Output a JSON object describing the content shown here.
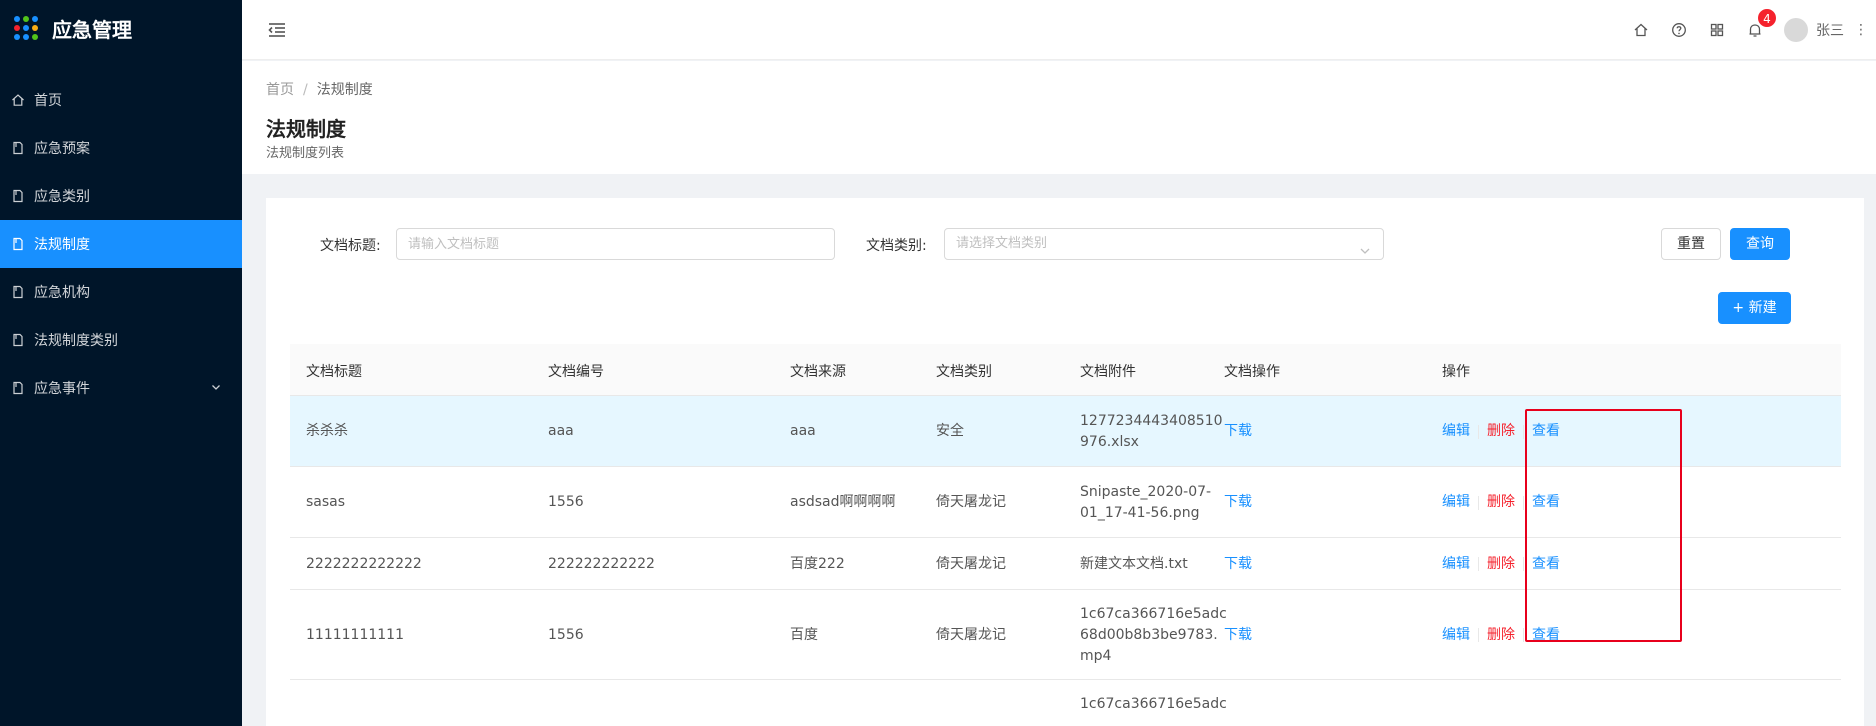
{
  "app": {
    "title": "应急管理",
    "logo_dots": [
      "#1890ff",
      "#52c41a",
      "#1890ff",
      "#f5222d",
      "#1890ff",
      "#faad14",
      "#1890ff",
      "#1890ff",
      "#52c41a"
    ]
  },
  "sidebar": {
    "items": [
      {
        "label": "首页",
        "icon": "home-icon",
        "active": false
      },
      {
        "label": "应急预案",
        "icon": "document-icon",
        "active": false
      },
      {
        "label": "应急类别",
        "icon": "document-icon",
        "active": false
      },
      {
        "label": "法规制度",
        "icon": "document-icon",
        "active": true
      },
      {
        "label": "应急机构",
        "icon": "document-icon",
        "active": false
      },
      {
        "label": "法规制度类别",
        "icon": "document-icon",
        "active": false
      },
      {
        "label": "应急事件",
        "icon": "document-icon",
        "active": false,
        "expandable": true
      }
    ]
  },
  "header": {
    "notification_count": "4",
    "user_name": "张三",
    "more": "⋮"
  },
  "breadcrumb": {
    "home": "首页",
    "sep": "/",
    "current": "法规制度"
  },
  "page": {
    "title": "法规制度",
    "subtitle": "法规制度列表"
  },
  "filters": {
    "title_label": "文档标题:",
    "title_placeholder": "请输入文档标题",
    "type_label": "文档类别:",
    "type_placeholder": "请选择文档类别",
    "reset_label": "重置",
    "query_label": "查询",
    "new_label": "+ 新建"
  },
  "table": {
    "columns": [
      "文档标题",
      "文档编号",
      "文档来源",
      "文档类别",
      "文档附件",
      "文档操作",
      "操作"
    ],
    "rows": [
      {
        "title": "杀杀杀",
        "code": "aaa",
        "source": "aaa",
        "type": "安全",
        "attachment": [
          "1277234443408510",
          "976.xlsx"
        ],
        "download": "下载",
        "edit": "编辑",
        "delete": "删除",
        "view": "查看"
      },
      {
        "title": "sasas",
        "code": "1556",
        "source": "asdsad啊啊啊啊",
        "type": "倚天屠龙记",
        "attachment": [
          "Snipaste_2020-07-",
          "01_17-41-56.png"
        ],
        "download": "下载",
        "edit": "编辑",
        "delete": "删除",
        "view": "查看"
      },
      {
        "title": "2222222222222",
        "code": "222222222222",
        "source": "百度222",
        "type": "倚天屠龙记",
        "attachment": [
          "新建文本文档.txt"
        ],
        "download": "下载",
        "edit": "编辑",
        "delete": "删除",
        "view": "查看"
      },
      {
        "title": "11111111111",
        "code": "1556",
        "source": "百度",
        "type": "倚天屠龙记",
        "attachment": [
          "1c67ca366716e5adc",
          "68d00b8b3be9783.",
          "mp4"
        ],
        "download": "下载",
        "edit": "编辑",
        "delete": "删除",
        "view": "查看"
      },
      {
        "title": "",
        "code": "",
        "source": "",
        "type": "",
        "attachment": [
          "1c67ca366716e5adc"
        ],
        "download": "",
        "edit": "",
        "delete": "",
        "view": ""
      }
    ]
  },
  "colors": {
    "sidebar_bg": "#001529",
    "primary": "#1890ff",
    "danger": "#f5222d",
    "highlight_row": "#e6f7ff",
    "annotation_box": "#e8001c"
  }
}
